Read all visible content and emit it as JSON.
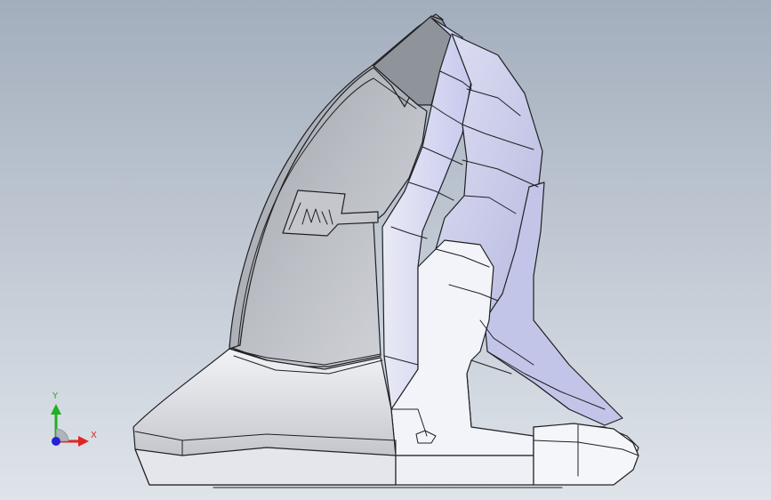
{
  "viewport": {
    "background_top": "#a3aebd",
    "background_bottom": "#dfe4ea",
    "model_body_color": "#d7d9df",
    "model_lit_color": "#f4f5f8",
    "model_shadow_color": "#8e9198",
    "edge_color": "#1f2024",
    "accent_purple": "#c9cbef"
  },
  "triad": {
    "x_label": "X",
    "y_label": "Y",
    "x_color": "#e32424",
    "y_color": "#20b024",
    "z_color": "#2222d6",
    "x_icon": "x-axis-arrow-icon",
    "y_icon": "y-axis-arrow-icon",
    "z_icon": "z-axis-origin-icon"
  }
}
